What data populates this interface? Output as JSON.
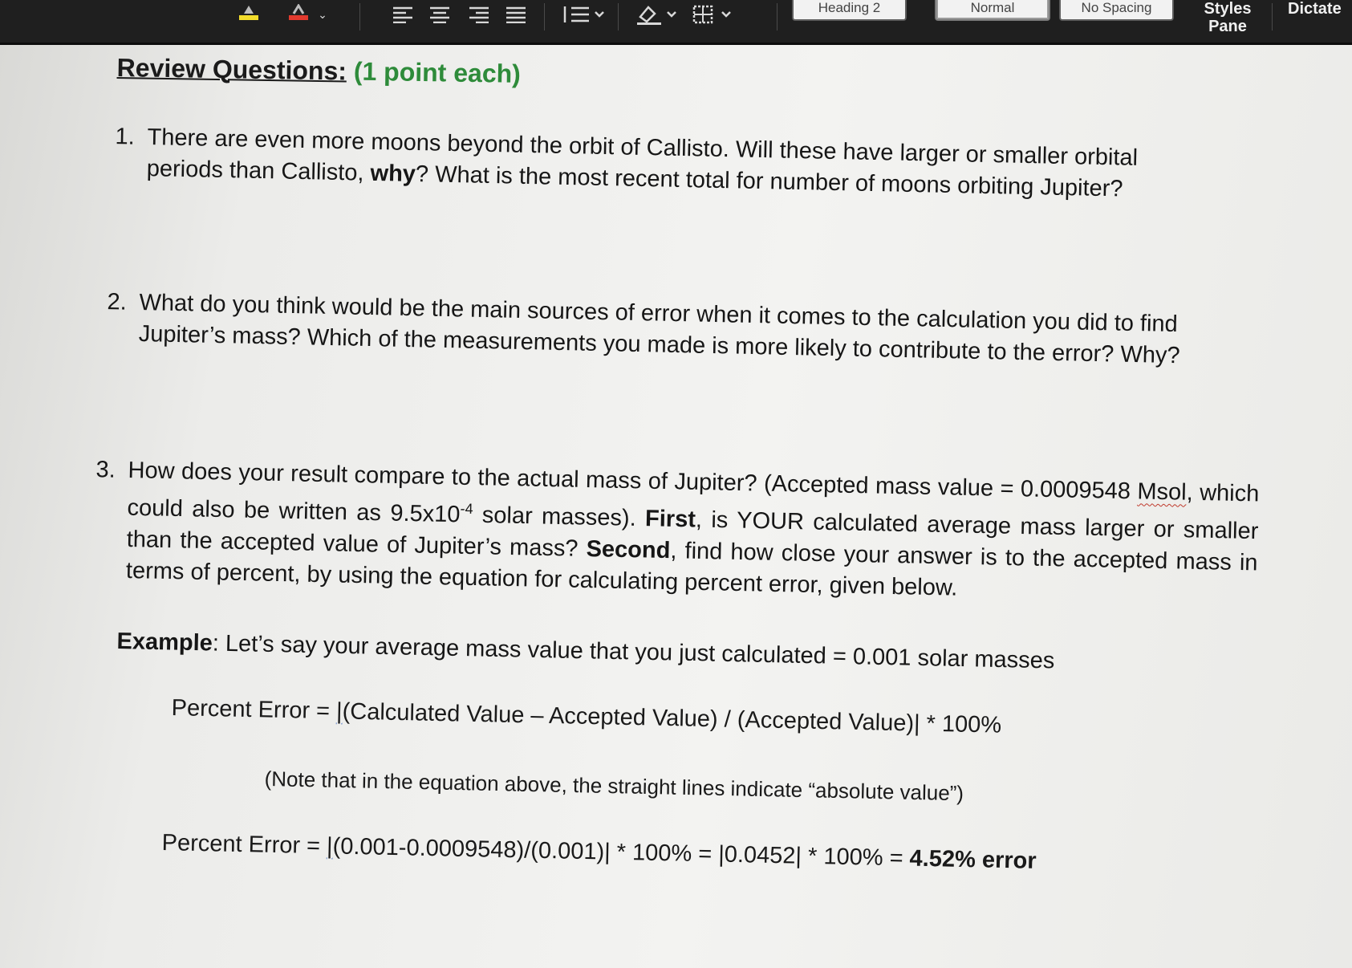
{
  "ribbon": {
    "styles": [
      "Heading 2",
      "Normal",
      "No Spacing"
    ],
    "styles_pane_line1": "Styles",
    "styles_pane_line2": "Pane",
    "dictate": "Dictate",
    "icons": [
      "align-left-icon",
      "align-center-icon",
      "align-right-icon",
      "justify-icon",
      "line-spacing-icon",
      "shading-icon",
      "borders-icon",
      "highlight-icon",
      "font-color-icon"
    ]
  },
  "doc": {
    "heading_title": "Review Questions:",
    "heading_points": "(1 point each)",
    "q1": {
      "num": "1.",
      "text_a": "There are even more moons beyond the orbit of Callisto. Will these have larger or smaller orbital periods than Callisto, ",
      "bold": "why",
      "text_b": "? What is the most recent total for number of moons orbiting Jupiter?"
    },
    "q2": {
      "num": "2.",
      "text": "What do you think would be the main sources of error when it comes to the calculation you did to find Jupiter’s mass? Which of the measurements you made is more likely to contribute to the error? Why?"
    },
    "q3": {
      "num": "3.",
      "text_a": "How does your result compare to the actual mass of Jupiter? (Accepted mass value = 0.0009548 ",
      "msol": "Msol",
      "text_b": ", which could also be written as 9.5x10",
      "exp": "-4",
      "text_c": " solar masses). ",
      "bold1": "First",
      "text_d": ", is YOUR calculated average mass larger or smaller than the accepted value of Jupiter’s mass? ",
      "bold2": "Second",
      "text_e": ", find how close your answer is to the accepted mass in terms of percent, by using the equation for calculating percent error, given below."
    },
    "example": {
      "label": "Example",
      "text": ": Let’s say your average mass value that you just calculated = 0.001 solar masses"
    },
    "formula1": {
      "lhs": "Percent Error = ",
      "bar": "|",
      "rhs": "(Calculated Value – Accepted Value) / (Accepted Value)| * 100%"
    },
    "note": "(Note that in the equation above, the straight lines indicate “absolute value”)",
    "formula2": {
      "lhs": "Percent Error = ",
      "bar": "|",
      "mid": "(0.001-0.0009548)/(0.001)| * 100% = |0.0452| * 100% = ",
      "result": "4.52% error"
    }
  }
}
